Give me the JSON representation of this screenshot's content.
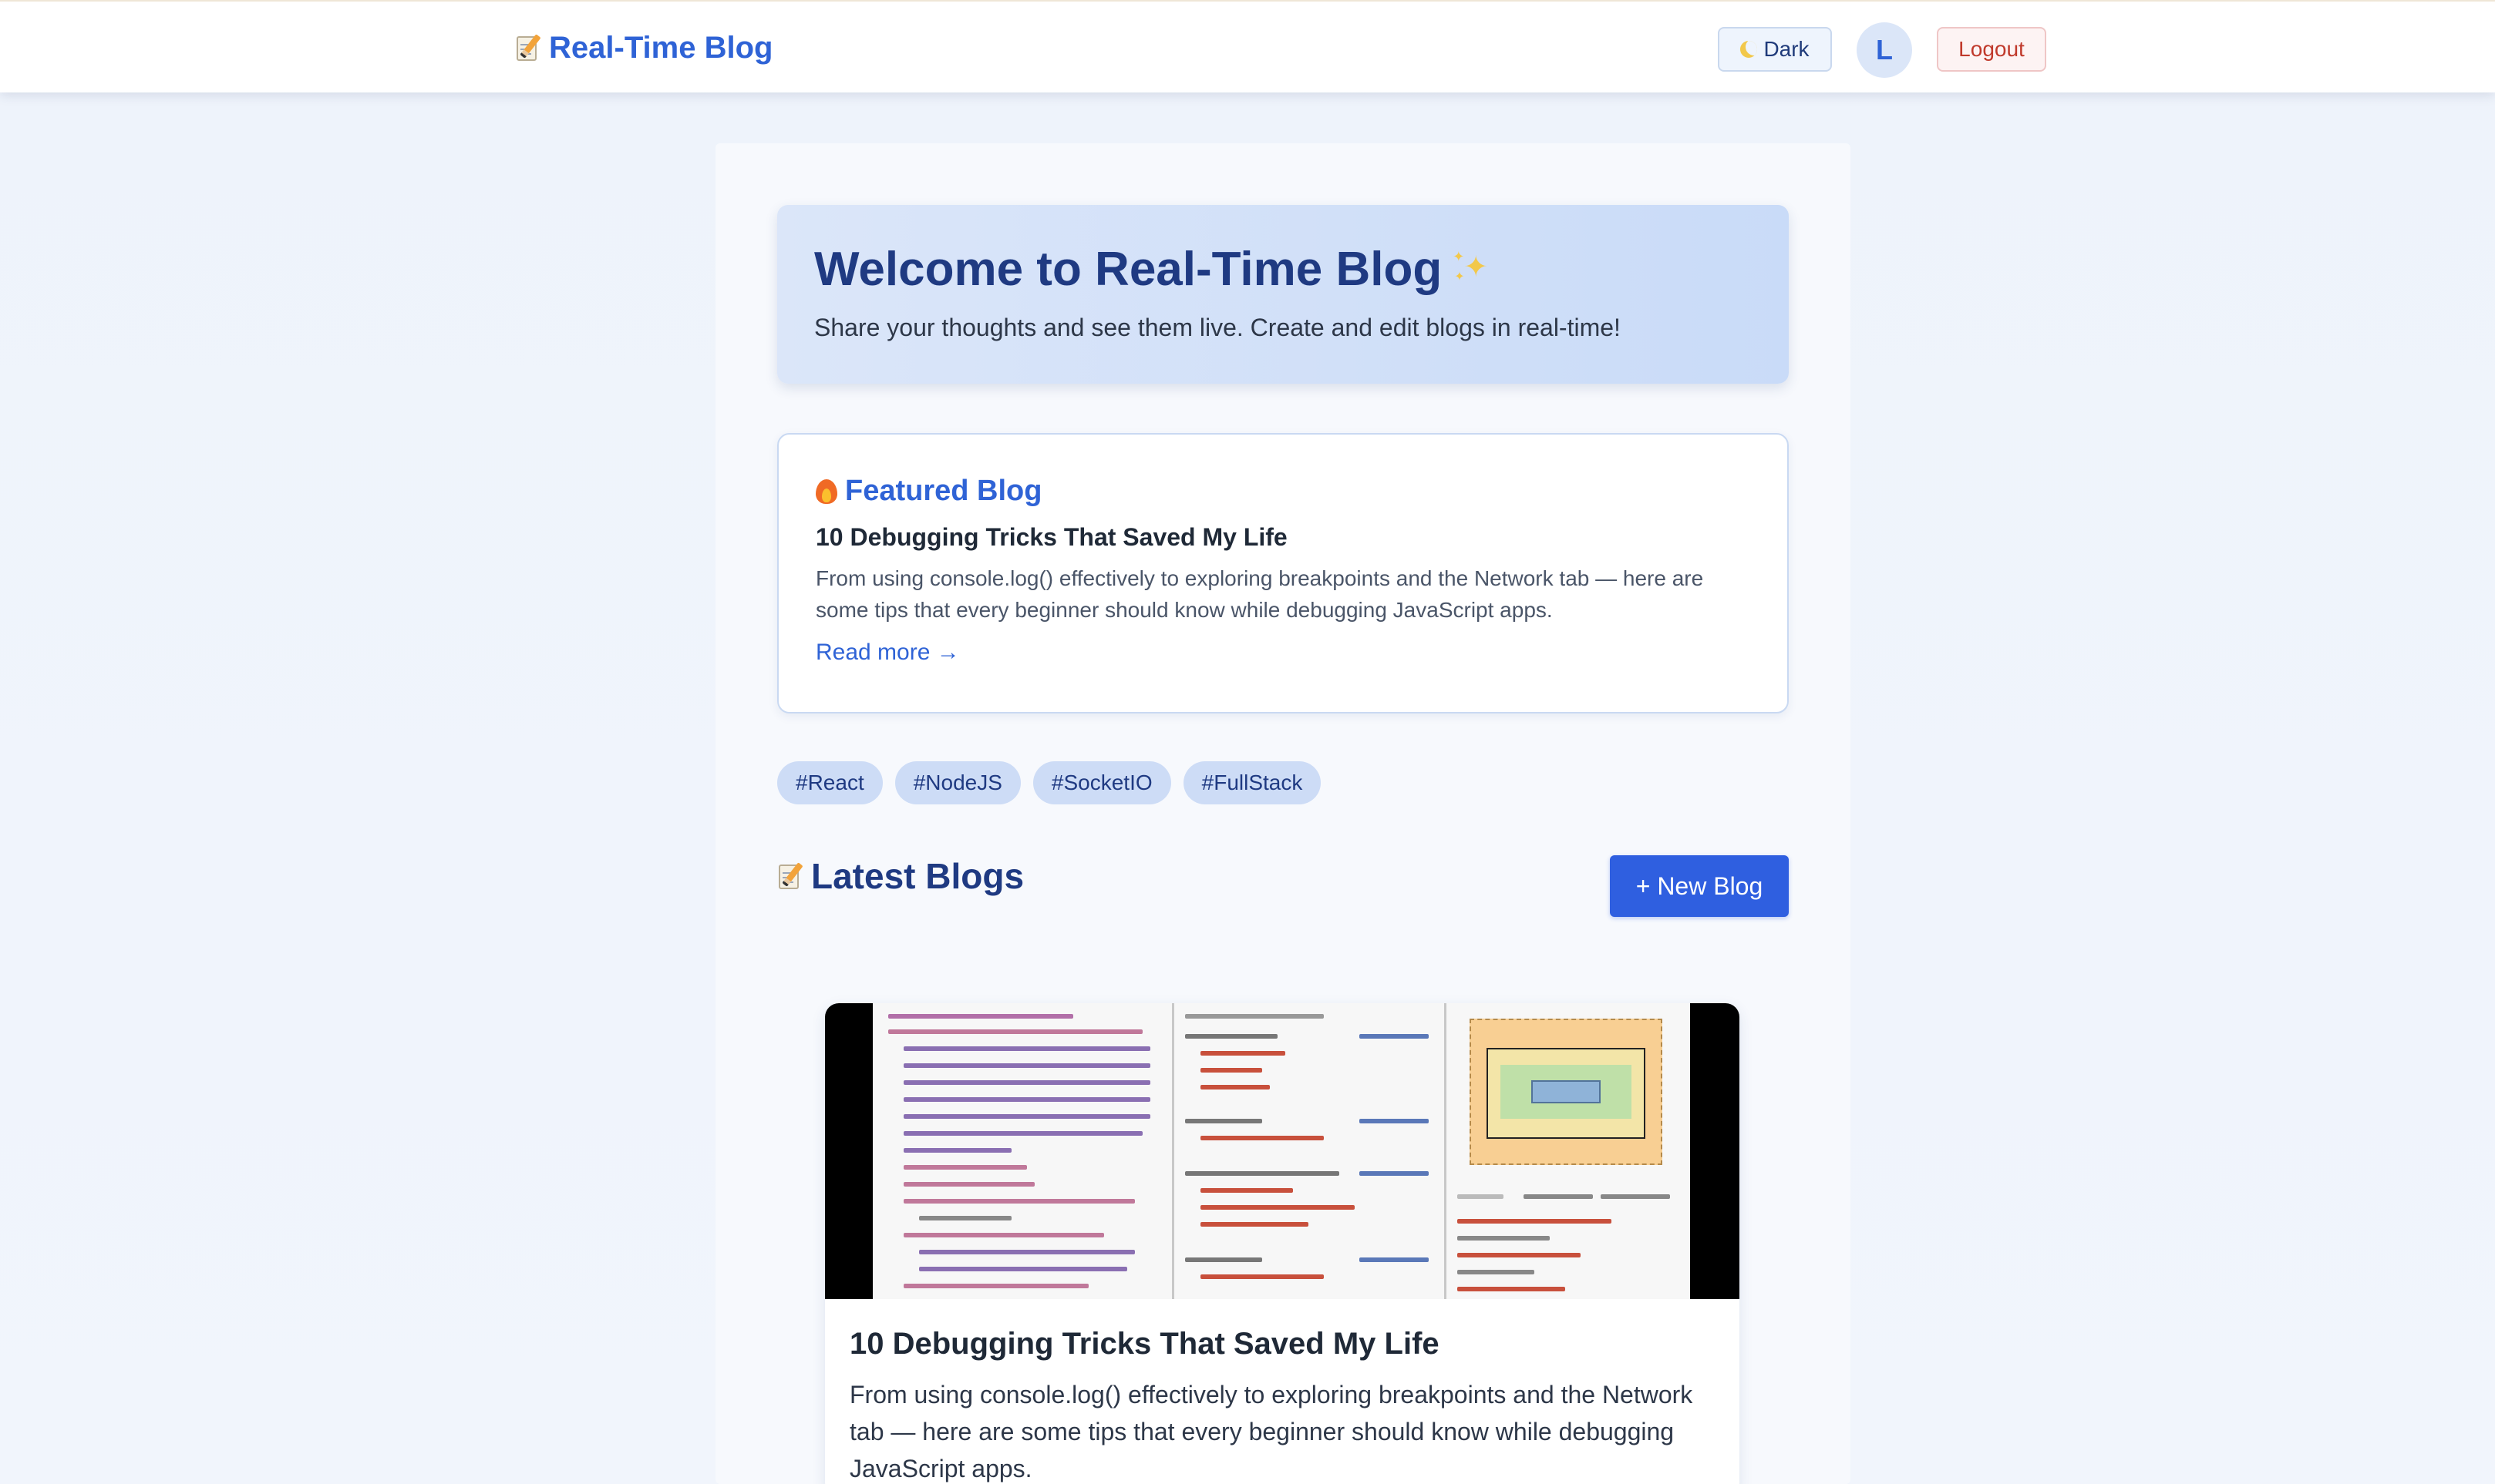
{
  "nav": {
    "brand": "Real-Time Blog",
    "brand_icon": "memo-icon",
    "dark_label": "Dark",
    "dark_icon": "moon-icon",
    "avatar_initial": "L",
    "logout_label": "Logout"
  },
  "hero": {
    "title": "Welcome to Real-Time Blog",
    "title_icon": "sparkles-icon",
    "subtitle": "Share your thoughts and see them live. Create and edit blogs in real-time!"
  },
  "featured": {
    "heading": "Featured Blog",
    "heading_icon": "fire-icon",
    "title": "10 Debugging Tricks That Saved My Life",
    "excerpt": "From using console.log() effectively to exploring breakpoints and the Network tab — here are some tips that every beginner should know while debugging JavaScript apps.",
    "read_more": "Read more →"
  },
  "tags": [
    "#React",
    "#NodeJS",
    "#SocketIO",
    "#FullStack"
  ],
  "latest": {
    "heading": "Latest Blogs",
    "heading_icon": "memo-icon",
    "new_blog_label": "+ New Blog"
  },
  "posts": [
    {
      "image_icon": "devtools-screenshot",
      "title": "10 Debugging Tricks That Saved My Life",
      "excerpt": "From using console.log() effectively to exploring breakpoints and the Network tab — here are some tips that every beginner should know while debugging JavaScript apps."
    }
  ],
  "colors": {
    "accent": "#2f63d6",
    "primary_button": "#2f5fe0",
    "heading_dark": "#1f3a82",
    "logout": "#c0392b",
    "tag_bg": "#cddcf6"
  }
}
